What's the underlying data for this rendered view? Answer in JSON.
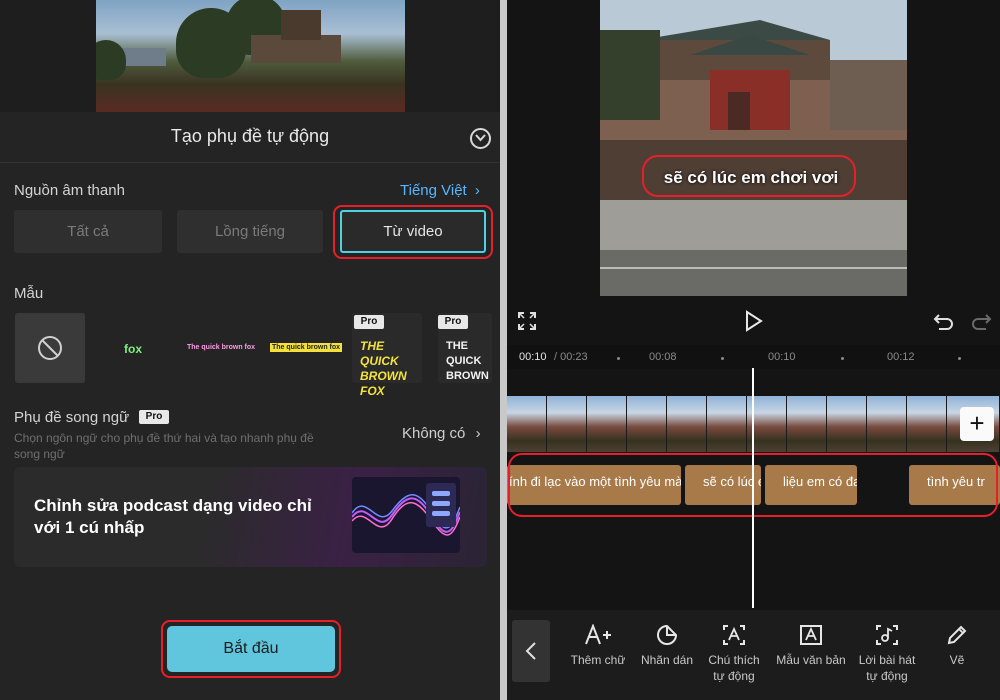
{
  "left": {
    "sheet_title": "Tạo phụ đề tự động",
    "audio_source": {
      "label": "Nguồn âm thanh",
      "language": "Tiếng Việt",
      "options": [
        "Tất cả",
        "Lồng tiếng",
        "Từ video"
      ],
      "selected": "Từ video"
    },
    "templates": {
      "label": "Mẫu",
      "items": [
        "fox",
        "The quick brown fox",
        "The quick brown fox",
        "THE QUICK BROWN FOX",
        "THE QUICK BROWN FOX"
      ],
      "pro_badge": "Pro"
    },
    "bilingual": {
      "label": "Phụ đề song ngữ",
      "pro_badge": "Pro",
      "description": "Chọn ngôn ngữ cho phụ đề thứ hai và tạo nhanh phụ đề song ngữ",
      "value": "Không có"
    },
    "banner": {
      "text": "Chỉnh sửa podcast dạng video chỉ với 1 cú nhấp"
    },
    "start_button": "Bắt đầu",
    "colors": {
      "accent": "#5fc6de",
      "highlight": "#e5202b",
      "link": "#5ab6ff"
    }
  },
  "right": {
    "preview_caption": "sẽ có lúc em chơi vơi",
    "timecode": {
      "current": "00:10",
      "total": "/ 00:23",
      "ticks": [
        "00:08",
        "00:10",
        "00:12"
      ]
    },
    "subtitle_clips": [
      "ính đi lạc vào một tình yêu mà",
      "sẽ có lúc em",
      "liệu em có đa",
      "tình yêu tr"
    ],
    "tools": [
      {
        "label": "Thêm chữ",
        "icon": "add-text-icon"
      },
      {
        "label": "Nhãn dán",
        "icon": "sticker-icon"
      },
      {
        "label": "Chú thích tự động",
        "icon": "auto-caption-icon"
      },
      {
        "label": "Mẫu văn bản",
        "icon": "text-template-icon"
      },
      {
        "label": "Lời bài hát tự động",
        "icon": "auto-lyrics-icon"
      },
      {
        "label": "Vẽ",
        "icon": "draw-icon"
      }
    ]
  }
}
